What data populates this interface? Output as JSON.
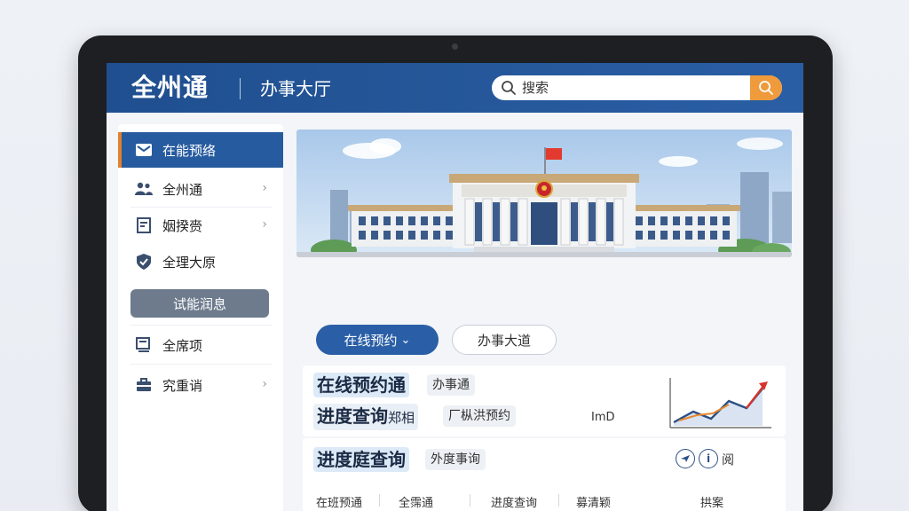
{
  "header": {
    "brand": "全州通",
    "subtitle": "办事大厅",
    "search_placeholder": "搜索"
  },
  "sidebar": {
    "items": [
      {
        "label": "在能预络",
        "icon": "inbox-icon",
        "active": true
      },
      {
        "label": "全州通",
        "icon": "users-icon",
        "chevron": true
      },
      {
        "label": "姻揆赍",
        "icon": "document-icon",
        "chevron": true
      },
      {
        "label": "全理大原",
        "icon": "shield-icon"
      },
      {
        "label": "试能润息",
        "pill": true
      },
      {
        "label": "全席项",
        "icon": "monitor-icon"
      },
      {
        "label": "究重诮",
        "icon": "briefcase-icon",
        "chevron": true
      }
    ]
  },
  "tabs": {
    "primary": "在线预约",
    "primary_chevron": "⌄",
    "secondary": "办事大道"
  },
  "card1": {
    "title1": "在线预约通",
    "chip1": "办事通",
    "title2": "进度查询",
    "title2_suffix": "郑相",
    "chip2": "厂枞洪预约",
    "right_text": "ImD"
  },
  "card2": {
    "title": "进度庭查询",
    "chip": "外度事询",
    "action_icon_text": "阅",
    "bottom_items": [
      "在班预通",
      "全霈通",
      "进度查询",
      "募清颖",
      "拱案"
    ]
  },
  "colors": {
    "header": "#1f4f8f",
    "accent_orange": "#ef9a3b",
    "sidebar_active": "#275b9f",
    "tab_primary": "#2a5fa7"
  }
}
